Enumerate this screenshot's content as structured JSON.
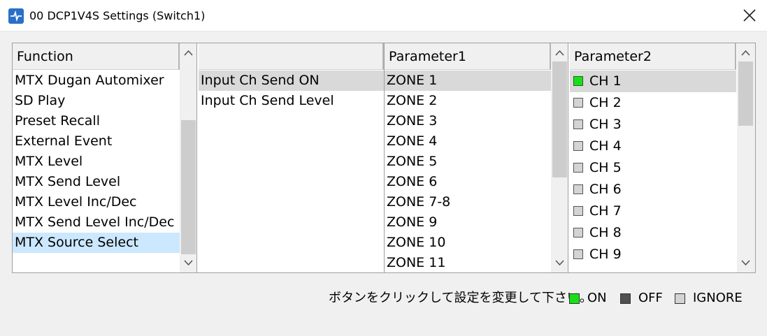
{
  "window": {
    "title": "00 DCP1V4S Settings (Switch1)"
  },
  "function_list": {
    "header": "Function",
    "items": [
      "MTX Dugan Automixer",
      "SD Play",
      "Preset Recall",
      "External Event",
      "MTX Level",
      "MTX Send Level",
      "MTX Level Inc/Dec",
      "MTX Send Level Inc/Dec",
      "MTX Source Select"
    ],
    "selected_index": 8
  },
  "sub_function_list": {
    "header": "",
    "items": [
      "Input Ch Send ON",
      "Input Ch Send Level"
    ],
    "selected_index": 0
  },
  "parameter1_list": {
    "header": "Parameter1",
    "items": [
      "ZONE 1",
      "ZONE 2",
      "ZONE 3",
      "ZONE 4",
      "ZONE 5",
      "ZONE 6",
      "ZONE 7-8",
      "ZONE 9",
      "ZONE 10",
      "ZONE 11"
    ],
    "selected_index": 0
  },
  "parameter2_list": {
    "header": "Parameter2",
    "items": [
      {
        "label": "CH 1",
        "state": "on"
      },
      {
        "label": "CH 2",
        "state": "ignore"
      },
      {
        "label": "CH 3",
        "state": "ignore"
      },
      {
        "label": "CH 4",
        "state": "ignore"
      },
      {
        "label": "CH 5",
        "state": "ignore"
      },
      {
        "label": "CH 6",
        "state": "ignore"
      },
      {
        "label": "CH 7",
        "state": "ignore"
      },
      {
        "label": "CH 8",
        "state": "ignore"
      },
      {
        "label": "CH 9",
        "state": "ignore"
      }
    ],
    "selected_index": 0
  },
  "legend": {
    "instruction": "ボタンをクリックして設定を変更して下さい。",
    "on_label": "ON",
    "off_label": "OFF",
    "ignore_label": "IGNORE"
  },
  "colors": {
    "on": "#17e017",
    "off": "#505050",
    "ignore": "#d4d4d4",
    "selection_blue": "#cce8ff",
    "selection_gray": "#d9d9d9",
    "app_icon": "#2a6fc9"
  },
  "icons": {
    "app": "app-icon",
    "close": "close-icon",
    "scroll_up": "chevron-up-icon",
    "scroll_down": "chevron-down-icon"
  }
}
